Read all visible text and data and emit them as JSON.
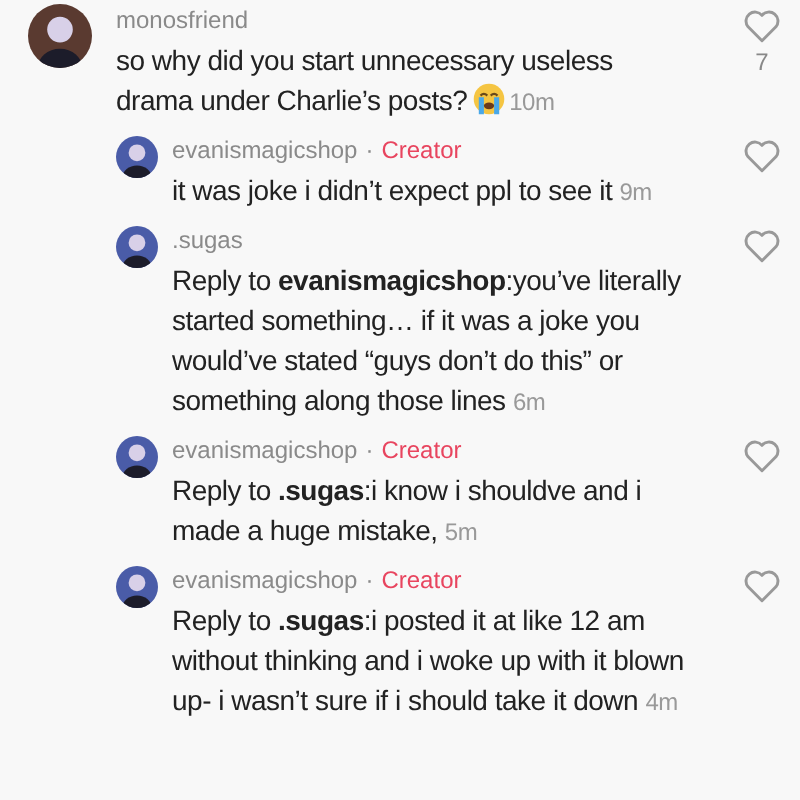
{
  "comments": [
    {
      "kind": "comment",
      "user": "monosfriend",
      "text": "so why did you start unnecessary useless drama under Charlie’s posts?",
      "emoji": true,
      "time": "10m",
      "likes": "7"
    },
    {
      "kind": "reply",
      "user": "evanismagicshop",
      "separator": "·",
      "badge": "Creator",
      "text": "it was joke i didn’t expect ppl to see it",
      "time": "9m"
    },
    {
      "kind": "reply",
      "user": ".sugas",
      "text": "Reply to **evanismagicshop**:you’ve literally started something… if it was a joke you would’ve stated “guys don’t do this” or something along those lines",
      "time": "6m"
    },
    {
      "kind": "reply",
      "user": "evanismagicshop",
      "separator": "·",
      "badge": "Creator",
      "text": "Reply to **.sugas**:i know i shouldve and i made a huge mistake,",
      "time": "5m"
    },
    {
      "kind": "reply",
      "user": "evanismagicshop",
      "separator": "·",
      "badge": "Creator",
      "text": "Reply to **.sugas**:i posted it at like 12 am without thinking and i woke up with it blown up- i wasn’t sure if i should take it down",
      "time": "4m"
    }
  ]
}
